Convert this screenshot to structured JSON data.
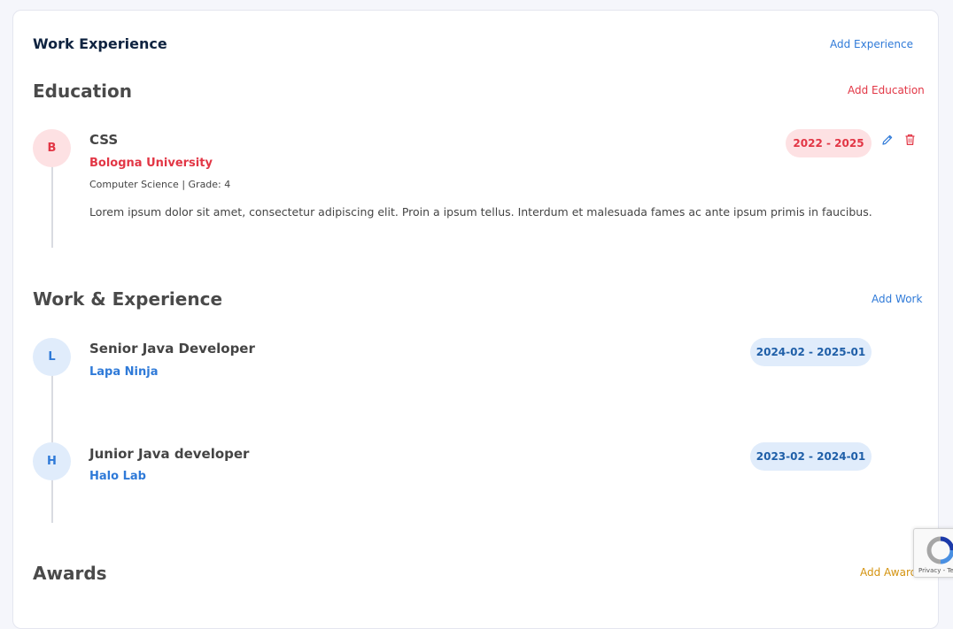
{
  "header": {
    "title": "Work Experience",
    "add_label": "Add Experience"
  },
  "education": {
    "title": "Education",
    "add_label": "Add Education",
    "items": [
      {
        "avatar": "B",
        "title": "CSS",
        "school": "Bologna University",
        "meta": "Computer Science | Grade: 4",
        "description": "Lorem ipsum dolor sit amet, consectetur adipiscing elit. Proin a ipsum tellus. Interdum et malesuada fames ac ante ipsum primis in faucibus.",
        "period": "2022 - 2025",
        "edit_icon": "pencil-icon",
        "delete_icon": "trash-icon"
      }
    ]
  },
  "work": {
    "title": "Work & Experience",
    "add_label": "Add Work",
    "items": [
      {
        "avatar": "L",
        "title": "Senior Java Developer",
        "company": "Lapa Ninja",
        "period": "2024-02 - 2025-01"
      },
      {
        "avatar": "H",
        "title": "Junior Java developer",
        "company": "Halo Lab",
        "period": "2023-02 - 2024-01"
      }
    ]
  },
  "awards": {
    "title": "Awards",
    "add_label": "Add Award"
  },
  "recaptcha": {
    "footer": "Privacy - Terms"
  },
  "colors": {
    "header_link": "#2f7ad8",
    "education_link": "#e23645",
    "work_link": "#2f7ad8",
    "awards_link": "#d4930f"
  }
}
